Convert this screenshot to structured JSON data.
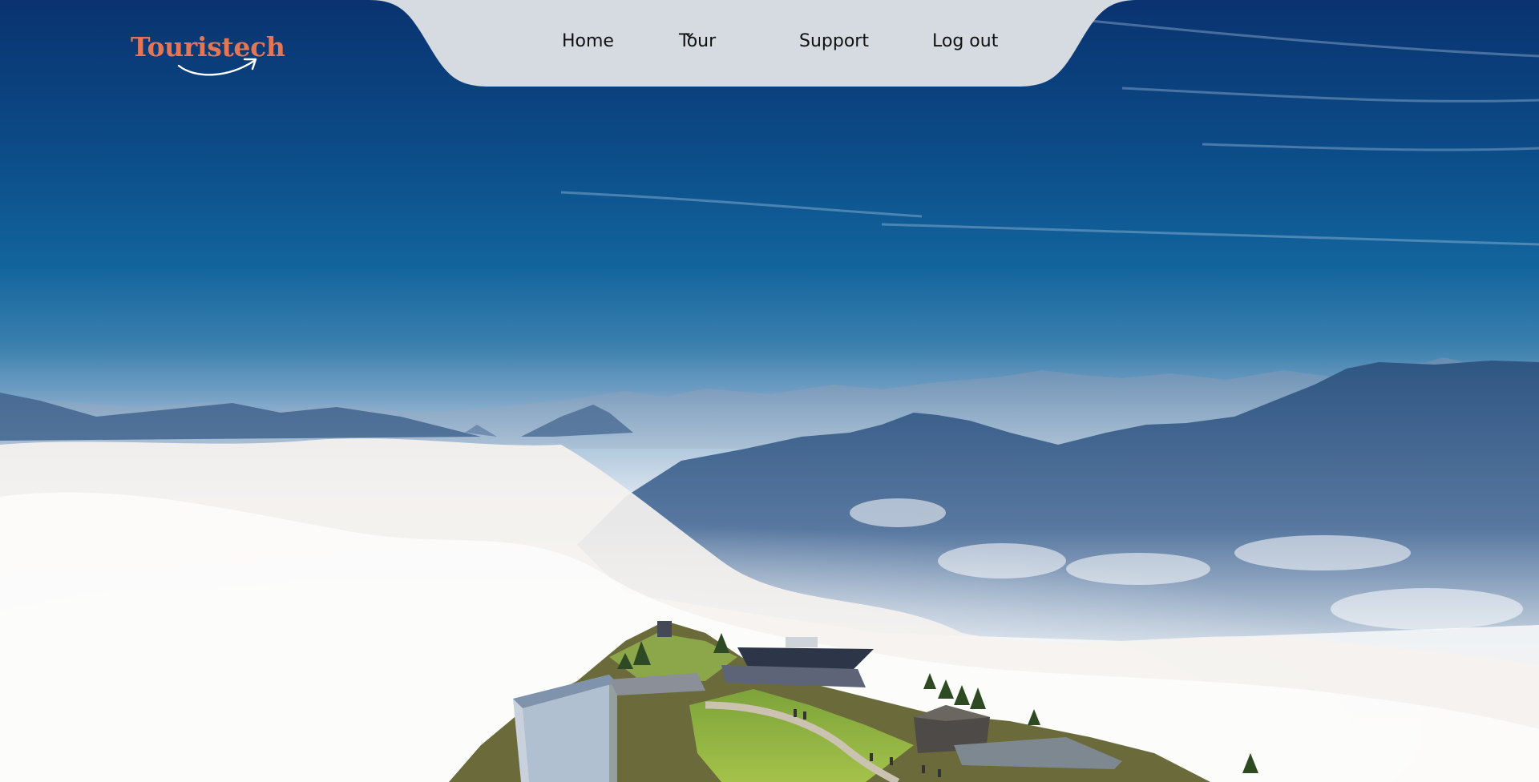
{
  "brand": {
    "name": "Touristech",
    "color": "#e47657",
    "arrow_icon": "swoosh-arrow-icon"
  },
  "nav": {
    "background": "#d5dbe0",
    "items": [
      {
        "label": "Home"
      },
      {
        "label": "Tour",
        "icon": "chevron-down-icon"
      },
      {
        "label": "Support"
      },
      {
        "label": "Log out"
      }
    ]
  },
  "hero": {
    "image": "mountain-summit-above-clouds"
  }
}
